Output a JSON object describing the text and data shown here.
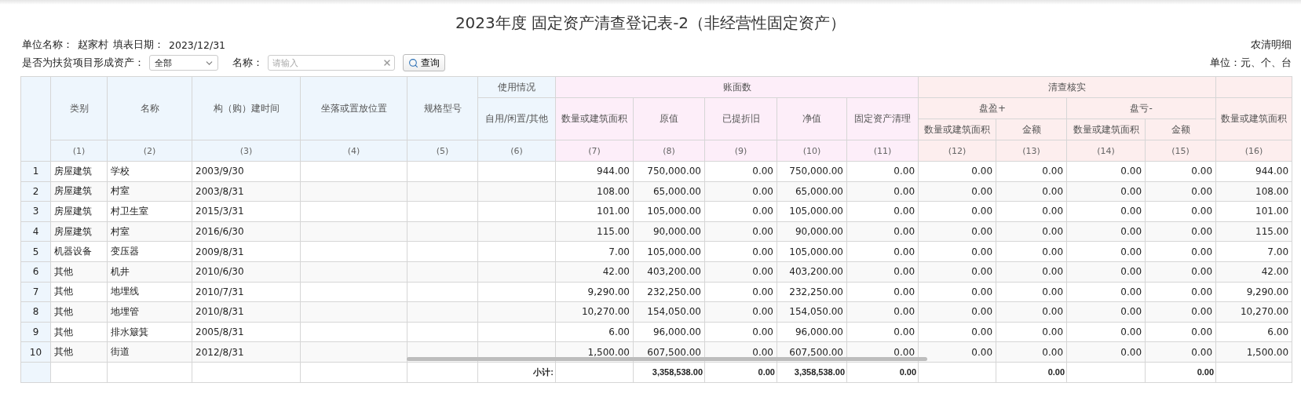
{
  "title": "2023年度 固定资产清查登记表-2（非经营性固定资产）",
  "info": {
    "unit_label": "单位名称：",
    "unit": "赵家村",
    "date_label": "填表日期：",
    "date": "2023/12/31",
    "report_code": "农清明细",
    "units": "单位：元、个、台"
  },
  "filters": {
    "poverty_label": "是否为扶贫项目形成资产：",
    "poverty_value": "全部",
    "name_label": "名称：",
    "name_placeholder": "请输入",
    "query_button": "查询"
  },
  "columns": [
    {
      "label": "类别"
    },
    {
      "label": "名称"
    },
    {
      "label": "构（购）建时间"
    },
    {
      "label": "坐落或置放位置"
    },
    {
      "label": "规格型号"
    },
    {
      "label": "使用情况",
      "children": [
        {
          "label": "自用/闲置/其他"
        }
      ]
    },
    {
      "label": "账面数",
      "children": [
        {
          "label": "数量或建筑面积"
        },
        {
          "label": "原值"
        },
        {
          "label": "已提折旧"
        },
        {
          "label": "净值"
        },
        {
          "label": "固定资产清理"
        }
      ]
    },
    {
      "label": "清查核实",
      "children": [
        {
          "label": "盘盈+",
          "children": [
            {
              "label": "数量或建筑面积"
            },
            {
              "label": "金额"
            }
          ]
        },
        {
          "label": "盘亏-",
          "children": [
            {
              "label": "数量或建筑面积"
            },
            {
              "label": "金额"
            }
          ]
        }
      ]
    },
    {
      "children": [
        {
          "label": "数量或建筑面积"
        }
      ]
    }
  ],
  "column_numbers": [
    "(1)",
    "(2)",
    "(3)",
    "(4)",
    "(5)",
    "(6)",
    "(7)",
    "(8)",
    "(9)",
    "(10)",
    "(11)",
    "(12)",
    "(13)",
    "(14)",
    "(15)",
    "(16)"
  ],
  "rows": [
    {
      "no": "1",
      "category": "房屋建筑",
      "name": "学校",
      "built": "2003/9/30",
      "qty": "944.00",
      "original": "750,000.00",
      "depreciated": "0.00",
      "net": "750,000.00",
      "cleanup": "0.00",
      "gain_qty": "0.00",
      "gain_amount": "0.00",
      "loss_qty": "0.00",
      "loss_amount": "0.00",
      "verified_qty": "944.00"
    },
    {
      "no": "2",
      "category": "房屋建筑",
      "name": "村室",
      "built": "2003/8/31",
      "qty": "108.00",
      "original": "65,000.00",
      "depreciated": "0.00",
      "net": "65,000.00",
      "cleanup": "0.00",
      "gain_qty": "0.00",
      "gain_amount": "0.00",
      "loss_qty": "0.00",
      "loss_amount": "0.00",
      "verified_qty": "108.00"
    },
    {
      "no": "3",
      "category": "房屋建筑",
      "name": "村卫生室",
      "built": "2015/3/31",
      "qty": "101.00",
      "original": "105,000.00",
      "depreciated": "0.00",
      "net": "105,000.00",
      "cleanup": "0.00",
      "gain_qty": "0.00",
      "gain_amount": "0.00",
      "loss_qty": "0.00",
      "loss_amount": "0.00",
      "verified_qty": "101.00"
    },
    {
      "no": "4",
      "category": "房屋建筑",
      "name": "村室",
      "built": "2016/6/30",
      "qty": "115.00",
      "original": "90,000.00",
      "depreciated": "0.00",
      "net": "90,000.00",
      "cleanup": "0.00",
      "gain_qty": "0.00",
      "gain_amount": "0.00",
      "loss_qty": "0.00",
      "loss_amount": "0.00",
      "verified_qty": "115.00"
    },
    {
      "no": "5",
      "category": "机器设备",
      "name": "变压器",
      "built": "2009/8/31",
      "qty": "7.00",
      "original": "105,000.00",
      "depreciated": "0.00",
      "net": "105,000.00",
      "cleanup": "0.00",
      "gain_qty": "0.00",
      "gain_amount": "0.00",
      "loss_qty": "0.00",
      "loss_amount": "0.00",
      "verified_qty": "7.00"
    },
    {
      "no": "6",
      "category": "其他",
      "name": "机井",
      "built": "2010/6/30",
      "qty": "42.00",
      "original": "403,200.00",
      "depreciated": "0.00",
      "net": "403,200.00",
      "cleanup": "0.00",
      "gain_qty": "0.00",
      "gain_amount": "0.00",
      "loss_qty": "0.00",
      "loss_amount": "0.00",
      "verified_qty": "42.00"
    },
    {
      "no": "7",
      "category": "其他",
      "name": "地埋线",
      "built": "2010/7/31",
      "qty": "9,290.00",
      "original": "232,250.00",
      "depreciated": "0.00",
      "net": "232,250.00",
      "cleanup": "0.00",
      "gain_qty": "0.00",
      "gain_amount": "0.00",
      "loss_qty": "0.00",
      "loss_amount": "0.00",
      "verified_qty": "9,290.00"
    },
    {
      "no": "8",
      "category": "其他",
      "name": "地埋管",
      "built": "2010/8/31",
      "qty": "10,270.00",
      "original": "154,050.00",
      "depreciated": "0.00",
      "net": "154,050.00",
      "cleanup": "0.00",
      "gain_qty": "0.00",
      "gain_amount": "0.00",
      "loss_qty": "0.00",
      "loss_amount": "0.00",
      "verified_qty": "10,270.00"
    },
    {
      "no": "9",
      "category": "其他",
      "name": "排水簸箕",
      "built": "2005/8/31",
      "qty": "6.00",
      "original": "96,000.00",
      "depreciated": "0.00",
      "net": "96,000.00",
      "cleanup": "0.00",
      "gain_qty": "0.00",
      "gain_amount": "0.00",
      "loss_qty": "0.00",
      "loss_amount": "0.00",
      "verified_qty": "6.00"
    },
    {
      "no": "10",
      "category": "其他",
      "name": "街道",
      "built": "2012/8/31",
      "qty": "1,500.00",
      "original": "607,500.00",
      "depreciated": "0.00",
      "net": "607,500.00",
      "cleanup": "0.00",
      "gain_qty": "0.00",
      "gain_amount": "0.00",
      "loss_qty": "0.00",
      "loss_amount": "0.00",
      "verified_qty": "1,500.00"
    }
  ],
  "subtotal": {
    "label": "小计:",
    "original": "3,358,538.00",
    "depreciated": "0.00",
    "net": "3,358,538.00",
    "cleanup": "0.00",
    "gain_amount": "0.00",
    "loss_amount": "0.00"
  }
}
